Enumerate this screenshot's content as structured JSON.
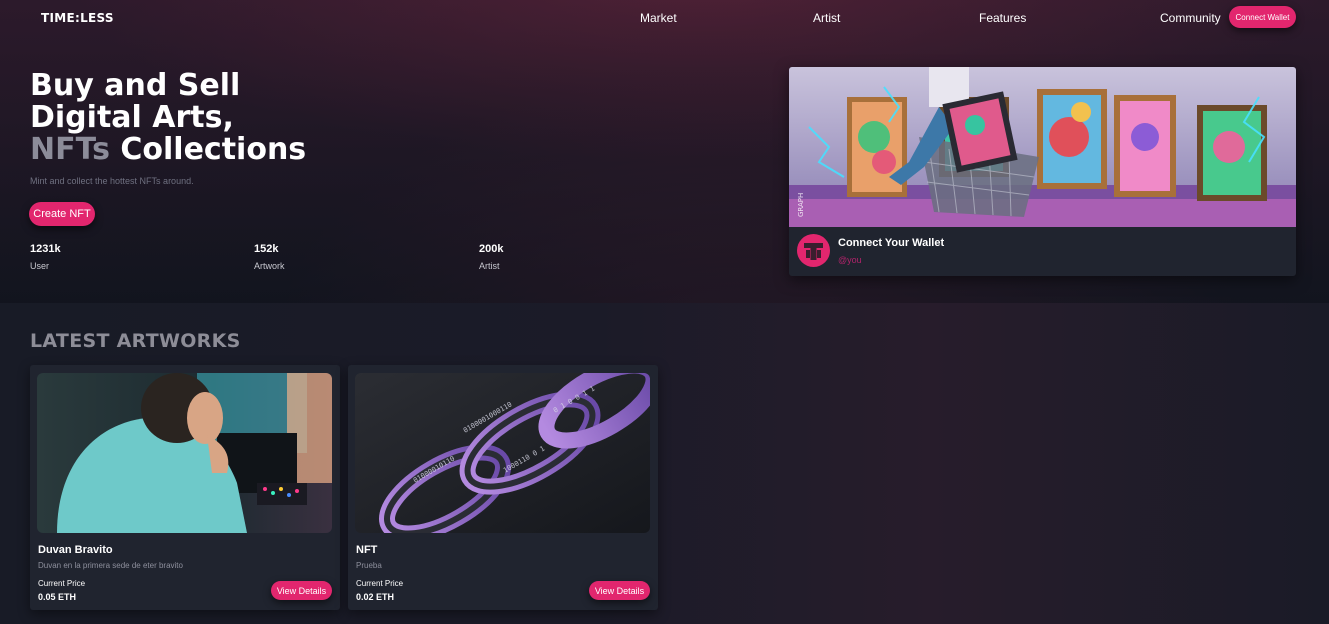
{
  "brand": {
    "logo": "TIME:LESS"
  },
  "nav": {
    "items": [
      "Market",
      "Artist",
      "Features",
      "Community"
    ],
    "connect_label": "Connect Wallet"
  },
  "hero": {
    "title_line1": "Buy and Sell",
    "title_line2": "Digital Arts,",
    "title_dim": "NFTs",
    "title_rest": " Collections",
    "subtitle": "Mint and collect the hottest NFTs around.",
    "create_label": "Create NFT",
    "stats": [
      {
        "value": "1231k",
        "label": "User"
      },
      {
        "value": "152k",
        "label": "Artwork"
      },
      {
        "value": "200k",
        "label": "Artist"
      }
    ]
  },
  "feature_card": {
    "title": "Connect Your Wallet",
    "handle": "@you"
  },
  "latest": {
    "heading": "LATEST ARTWORKS",
    "cards": [
      {
        "title": "Duvan Bravito",
        "description": "Duvan en la primera sede de eter bravito",
        "price_label": "Current Price",
        "price": "0.05 ETH",
        "button": "View Details"
      },
      {
        "title": "NFT",
        "description": "Prueba",
        "price_label": "Current Price",
        "price": "0.02 ETH",
        "button": "View Details"
      }
    ]
  },
  "colors": {
    "accent": "#e2266e",
    "card_bg": "#20242f",
    "page_bg": "#171a26"
  }
}
